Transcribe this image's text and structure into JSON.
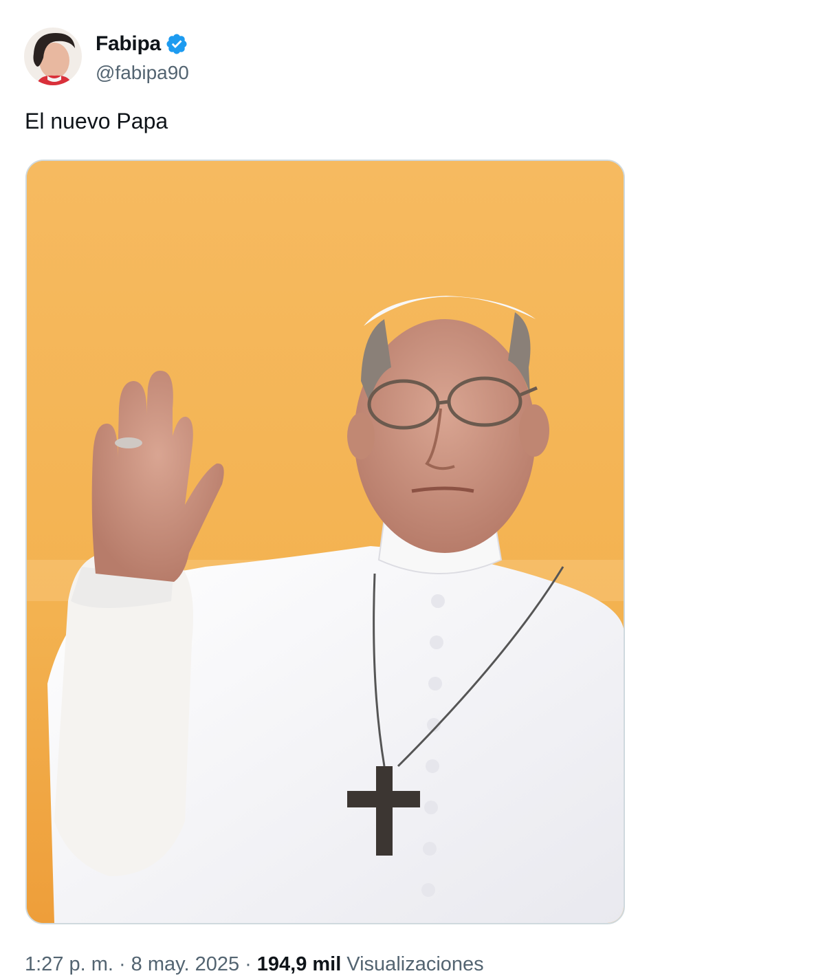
{
  "author": {
    "display_name": "Fabipa",
    "handle": "@fabipa90",
    "verified": true,
    "verified_color": "#1d9bf0"
  },
  "tweet": {
    "text": "El nuevo Papa"
  },
  "media": {
    "type": "photo",
    "icon": "photo-icon",
    "background_color": "#f4b65a"
  },
  "meta": {
    "time": "1:27 p. m.",
    "separator": "·",
    "date": "8 may. 2025",
    "views_count": "194,9 mil",
    "views_label": "Visualizaciones"
  },
  "colors": {
    "text_primary": "#0f1419",
    "text_secondary": "#536471",
    "border": "#cfd9de"
  }
}
